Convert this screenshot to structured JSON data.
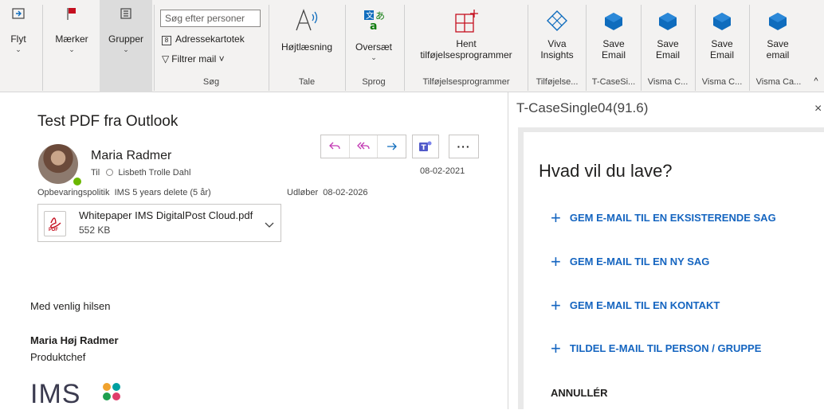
{
  "ribbon": {
    "flyt": "Flyt",
    "maerker": "Mærker",
    "grupper": "Grupper",
    "search_placeholder": "Søg efter personer",
    "adressekartotek": "Adressekartotek",
    "filtrer_mail": "Filtrer mail ˅",
    "group_soeg": "Søg",
    "hojtlaesning": "Højtlæsning",
    "group_tale": "Tale",
    "oversaet": "Oversæt",
    "group_sprog": "Sprog",
    "hent": "Hent",
    "tilfoejelsesprogrammer": "tilføjelsesprogrammer",
    "group_tilfoejelses": "Tilføjelsesprogrammer",
    "viva": "Viva",
    "insights": "Insights",
    "group_tilfoejelse_short": "Tilføjelse...",
    "save": "Save",
    "email": "Email",
    "email_lower": "email",
    "group_tcase": "T-CaseSi...",
    "group_visma1": "Visma C...",
    "group_visma2": "Visma C...",
    "group_visma3": "Visma Ca...",
    "colors": {
      "flag": "#c50f1f",
      "addin_blue": "#1565c0",
      "icon_blue": "#0f6cbd"
    }
  },
  "message": {
    "subject": "Test  PDF fra Outlook",
    "sender": "Maria Radmer",
    "to_prefix": "Til",
    "to_name": "Lisbeth Trolle Dahl",
    "date": "08-02-2021",
    "policy_label": "Opbevaringspolitik",
    "policy_value": "IMS 5 years delete (5 år)",
    "expiry_label": "Udløber",
    "expiry_value": "08-02-2026",
    "attachment": {
      "name": "Whitepaper IMS DigitalPost Cloud.pdf",
      "size": "552 KB",
      "icon_text": "PDF"
    },
    "body": {
      "greeting": "Med venlig hilsen",
      "sig_name": "Maria Høj Radmer",
      "sig_title": "Produktchef",
      "logo_text": "IMS"
    }
  },
  "addin": {
    "title": "T-CaseSingle04(91.6)",
    "close": "×",
    "heading": "Hvad vil du lave?",
    "options": [
      "GEM E-MAIL TIL EN EKSISTERENDE SAG",
      "GEM E-MAIL TIL EN NY SAG",
      "GEM E-MAIL TIL EN KONTAKT",
      "TILDEL E-MAIL TIL PERSON / GRUPPE"
    ],
    "cancel": "ANNULLÉR"
  }
}
